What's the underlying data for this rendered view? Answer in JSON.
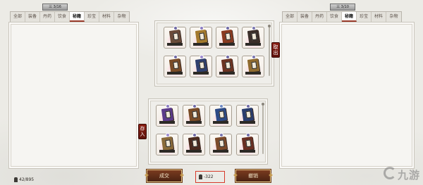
{
  "left": {
    "page_label": "三 3/16",
    "tabs": [
      "全部",
      "装备",
      "丹药",
      "饮食",
      "秘籍",
      "珍宝",
      "材料",
      "杂物"
    ],
    "active_tab": 4,
    "counter": "42/895"
  },
  "right": {
    "page_label": "三 3/10",
    "tabs": [
      "全部",
      "装备",
      "丹药",
      "饮食",
      "秘籍",
      "珍宝",
      "材料",
      "杂物"
    ],
    "active_tab": 4
  },
  "middle": {
    "take_out_label": "取出",
    "store_label": "存入"
  },
  "buttons": {
    "confirm_label": "成交",
    "cancel_label": "撤销"
  },
  "center_counter": "-322",
  "watermark": "九游",
  "colors": {
    "accent": "#8a1f14",
    "highlight": "#d63a2a",
    "button_bg": "#5e2d17"
  }
}
